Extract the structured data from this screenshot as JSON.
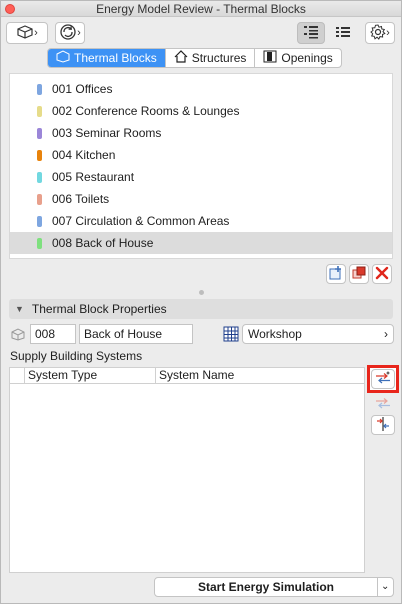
{
  "window": {
    "title": "Energy Model Review - Thermal Blocks"
  },
  "tabs": [
    {
      "label": "Thermal Blocks",
      "icon": "thermal-block-icon",
      "selected": true
    },
    {
      "label": "Structures",
      "icon": "house-icon",
      "selected": false
    },
    {
      "label": "Openings",
      "icon": "door-icon",
      "selected": false
    }
  ],
  "thermal_blocks": [
    {
      "label": "001 Offices",
      "color": "#7ea6e0"
    },
    {
      "label": "002 Conference Rooms & Lounges",
      "color": "#e6dc8a"
    },
    {
      "label": "003 Seminar Rooms",
      "color": "#9b86d8"
    },
    {
      "label": "004 Kitchen",
      "color": "#e8830c"
    },
    {
      "label": "005 Restaurant",
      "color": "#72d8e0"
    },
    {
      "label": "006 Toilets",
      "color": "#e8a08c"
    },
    {
      "label": "007 Circulation & Common Areas",
      "color": "#7ea6e0"
    },
    {
      "label": "008 Back of House",
      "color": "#7ee07e",
      "selected": true
    }
  ],
  "properties": {
    "header": "Thermal Block Properties",
    "id_value": "008",
    "name_value": "Back of House",
    "profile_value": "Workshop"
  },
  "systems": {
    "section_label": "Supply Building Systems",
    "columns": [
      "System Type",
      "System Name"
    ]
  },
  "footer": {
    "simulate_label": "Start Energy Simulation"
  }
}
